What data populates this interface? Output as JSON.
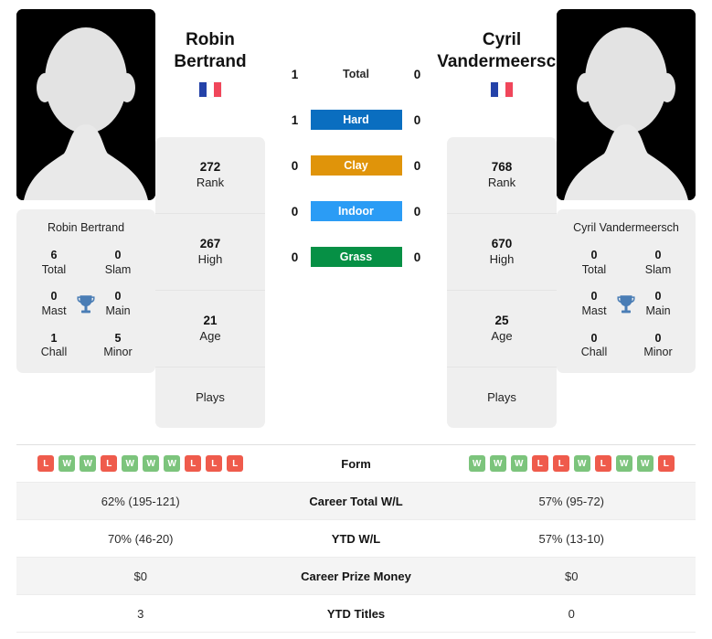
{
  "players": {
    "left": {
      "name_line1": "Robin",
      "name_line2": "Bertrand",
      "full_name": "Robin Bertrand",
      "country_flag": "france-flag",
      "rank": "272",
      "rank_label": "Rank",
      "high": "267",
      "high_label": "High",
      "age": "21",
      "age_label": "Age",
      "plays_label": "Plays",
      "titles": {
        "total": "6",
        "total_label": "Total",
        "slam": "0",
        "slam_label": "Slam",
        "mast": "0",
        "mast_label": "Mast",
        "main": "0",
        "main_label": "Main",
        "chall": "1",
        "chall_label": "Chall",
        "minor": "5",
        "minor_label": "Minor"
      }
    },
    "right": {
      "name_line1": "Cyril",
      "name_line2": "Vandermeersch",
      "full_name": "Cyril Vandermeersch",
      "country_flag": "france-flag",
      "rank": "768",
      "rank_label": "Rank",
      "high": "670",
      "high_label": "High",
      "age": "25",
      "age_label": "Age",
      "plays_label": "Plays",
      "titles": {
        "total": "0",
        "total_label": "Total",
        "slam": "0",
        "slam_label": "Slam",
        "mast": "0",
        "mast_label": "Mast",
        "main": "0",
        "main_label": "Main",
        "chall": "0",
        "chall_label": "Chall",
        "minor": "0",
        "minor_label": "Minor"
      }
    }
  },
  "head_to_head": [
    {
      "label": "Total",
      "left": "1",
      "right": "0",
      "color": "none",
      "text_color": "#2a2a2a"
    },
    {
      "label": "Hard",
      "left": "1",
      "right": "0",
      "color": "#0a6ec0",
      "text_color": "#ffffff"
    },
    {
      "label": "Clay",
      "left": "0",
      "right": "0",
      "color": "#e0940a",
      "text_color": "#ffffff"
    },
    {
      "label": "Indoor",
      "left": "0",
      "right": "0",
      "color": "#2b9cf5",
      "text_color": "#ffffff"
    },
    {
      "label": "Grass",
      "left": "0",
      "right": "0",
      "color": "#069045",
      "text_color": "#ffffff"
    }
  ],
  "comparison_table": {
    "form_label": "Form",
    "form_left": [
      "L",
      "W",
      "W",
      "L",
      "W",
      "W",
      "W",
      "L",
      "L",
      "L"
    ],
    "form_right": [
      "W",
      "W",
      "W",
      "L",
      "L",
      "W",
      "L",
      "W",
      "W",
      "L"
    ],
    "rows": [
      {
        "label": "Career Total W/L",
        "left": "62% (195-121)",
        "right": "57% (95-72)"
      },
      {
        "label": "YTD W/L",
        "left": "70% (46-20)",
        "right": "57% (13-10)"
      },
      {
        "label": "Career Prize Money",
        "left": "$0",
        "right": "$0"
      },
      {
        "label": "YTD Titles",
        "left": "3",
        "right": "0"
      }
    ]
  },
  "colors": {
    "win_badge": "#7cc47c",
    "loss_badge": "#ef5b4c",
    "trophy": "#4a7db5",
    "card_bg": "#efefef"
  }
}
